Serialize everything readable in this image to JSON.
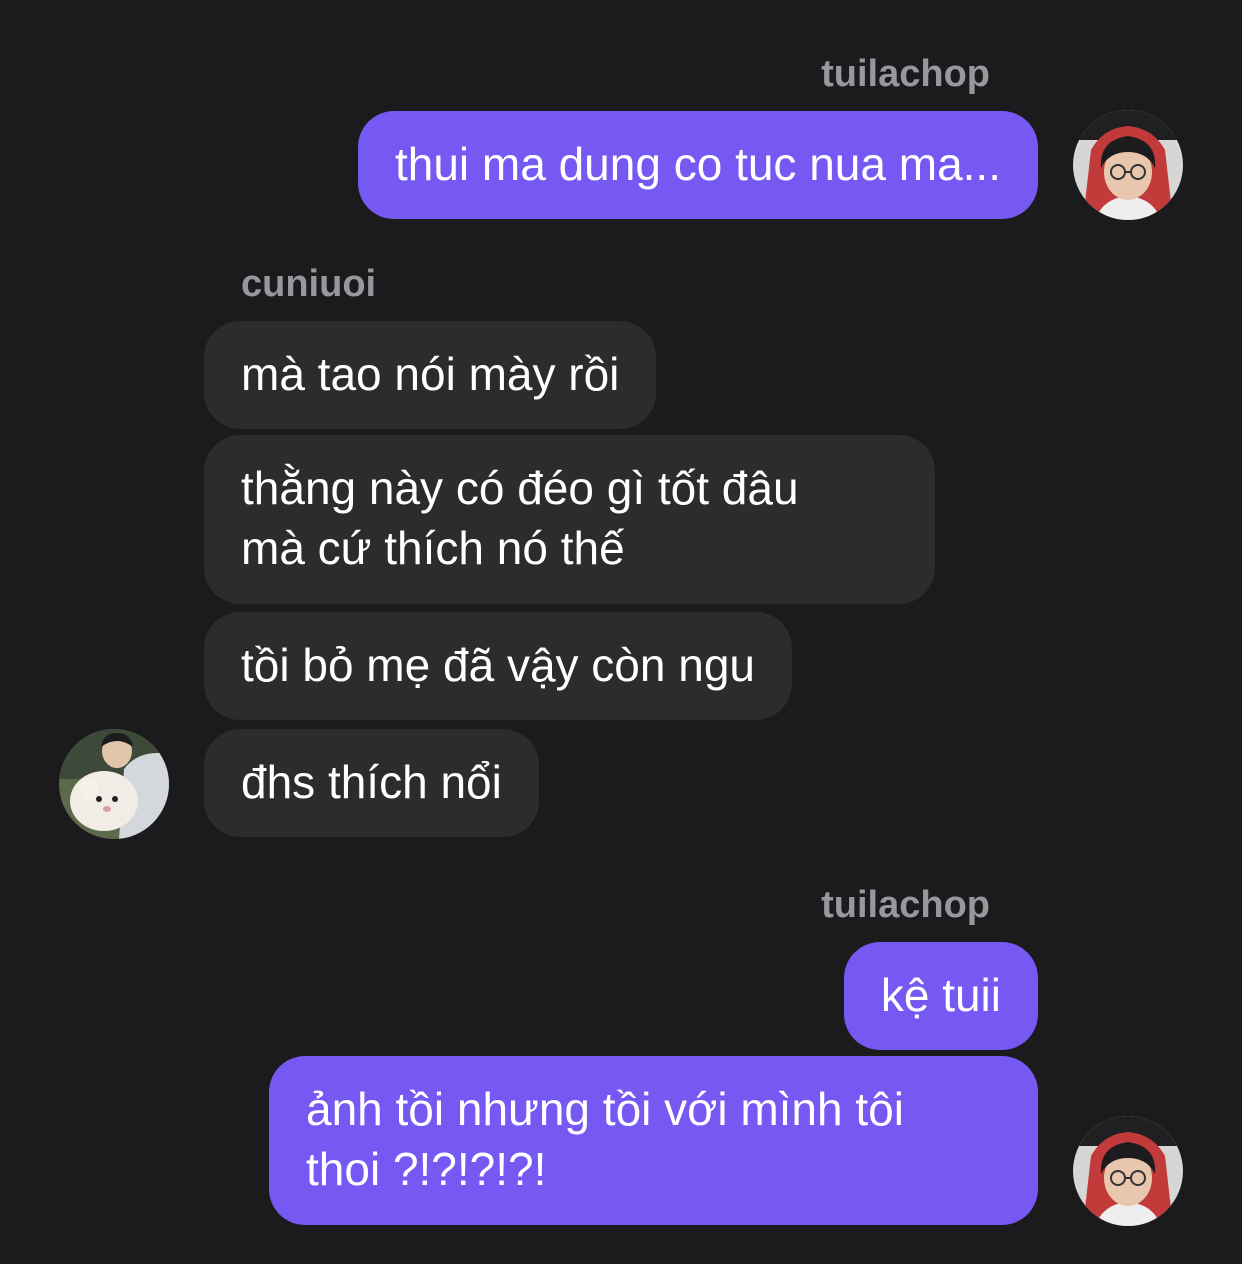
{
  "messages": [
    {
      "sender": "tuilachop",
      "text": "thui ma dung co tuc nua ma..."
    },
    {
      "sender": "cuniuoi",
      "text": "mà tao nói mày rồi"
    },
    {
      "text_line1": "thằng này có đéo gì tốt đâu",
      "text_line2": "mà cứ thích nó thế"
    },
    {
      "text": "tồi bỏ mẹ đã vậy còn ngu"
    },
    {
      "text": "đhs thích nổi"
    },
    {
      "sender": "tuilachop",
      "text": "kệ tuii"
    },
    {
      "text_line1": "ảnh tồi nhưng tồi với mình tôi",
      "text_line2": "thoi ?!?!?!?!"
    }
  ],
  "colors": {
    "background": "#1b1b1d",
    "outgoing_bubble": "#7659f2",
    "incoming_bubble": "#2c2c2f",
    "sender_label": "#98979c"
  }
}
